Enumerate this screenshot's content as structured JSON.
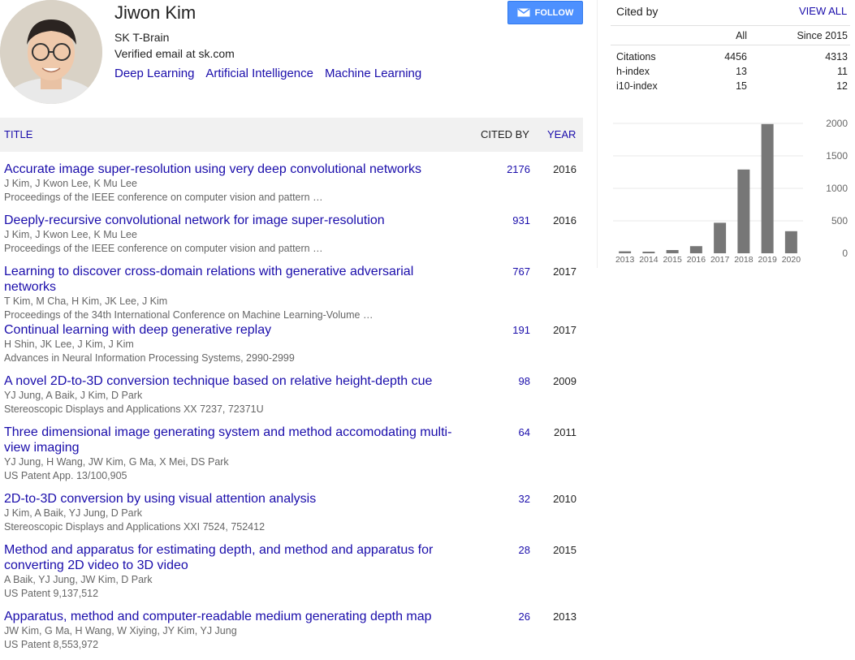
{
  "profile": {
    "name": "Jiwon Kim",
    "affiliation": "SK T-Brain",
    "email": "Verified email at sk.com",
    "interests": [
      "Deep Learning",
      "Artificial Intelligence",
      "Machine Learning"
    ],
    "follow_label": "FOLLOW"
  },
  "table": {
    "headers": {
      "title": "TITLE",
      "cited_by": "CITED BY",
      "year": "YEAR"
    },
    "rows": [
      {
        "title": "Accurate image super-resolution using very deep convolutional networks",
        "authors": "J Kim, J Kwon Lee, K Mu Lee",
        "venue": "Proceedings of the IEEE conference on computer vision and pattern …",
        "cited": "2176",
        "year": "2016"
      },
      {
        "title": "Deeply-recursive convolutional network for image super-resolution",
        "authors": "J Kim, J Kwon Lee, K Mu Lee",
        "venue": "Proceedings of the IEEE conference on computer vision and pattern …",
        "cited": "931",
        "year": "2016"
      },
      {
        "title": "Learning to discover cross-domain relations with generative adversarial networks",
        "authors": "T Kim, M Cha, H Kim, JK Lee, J Kim",
        "venue": "Proceedings of the 34th International Conference on Machine Learning-Volume …",
        "cited": "767",
        "year": "2017"
      },
      {
        "title": "Continual learning with deep generative replay",
        "authors": "H Shin, JK Lee, J Kim, J Kim",
        "venue": "Advances in Neural Information Processing Systems, 2990-2999",
        "cited": "191",
        "year": "2017"
      },
      {
        "title": "A novel 2D-to-3D conversion technique based on relative height-depth cue",
        "authors": "YJ Jung, A Baik, J Kim, D Park",
        "venue": "Stereoscopic Displays and Applications XX 7237, 72371U",
        "cited": "98",
        "year": "2009"
      },
      {
        "title": "Three dimensional image generating system and method accomodating multi-view imaging",
        "authors": "YJ Jung, H Wang, JW Kim, G Ma, X Mei, DS Park",
        "venue": "US Patent App. 13/100,905",
        "cited": "64",
        "year": "2011"
      },
      {
        "title": "2D-to-3D conversion by using visual attention analysis",
        "authors": "J Kim, A Baik, YJ Jung, D Park",
        "venue": "Stereoscopic Displays and Applications XXI 7524, 752412",
        "cited": "32",
        "year": "2010"
      },
      {
        "title": "Method and apparatus for estimating depth, and method and apparatus for converting 2D video to 3D video",
        "authors": "A Baik, YJ Jung, JW Kim, D Park",
        "venue": "US Patent 9,137,512",
        "cited": "28",
        "year": "2015"
      },
      {
        "title": "Apparatus, method and computer-readable medium generating depth map",
        "authors": "JW Kim, G Ma, H Wang, W Xiying, JY Kim, YJ Jung",
        "venue": "US Patent 8,553,972",
        "cited": "26",
        "year": "2013"
      }
    ]
  },
  "cited_by": {
    "title": "Cited by",
    "view_all": "VIEW ALL",
    "col_all": "All",
    "col_since": "Since 2015",
    "metrics": [
      {
        "label": "Citations",
        "all": "4456",
        "since": "4313"
      },
      {
        "label": "h-index",
        "all": "13",
        "since": "11"
      },
      {
        "label": "i10-index",
        "all": "15",
        "since": "12"
      }
    ]
  },
  "colors": {
    "link": "#1a0dab",
    "button": "#4d90fe",
    "bar": "#777777"
  },
  "chart_data": {
    "type": "bar",
    "categories": [
      "2013",
      "2014",
      "2015",
      "2016",
      "2017",
      "2018",
      "2019",
      "2020"
    ],
    "values": [
      30,
      25,
      50,
      110,
      470,
      1290,
      1990,
      340
    ],
    "ylim": [
      0,
      2000
    ],
    "yticks": [
      0,
      500,
      1000,
      1500,
      2000
    ],
    "axis_side": "right",
    "grid": true
  }
}
